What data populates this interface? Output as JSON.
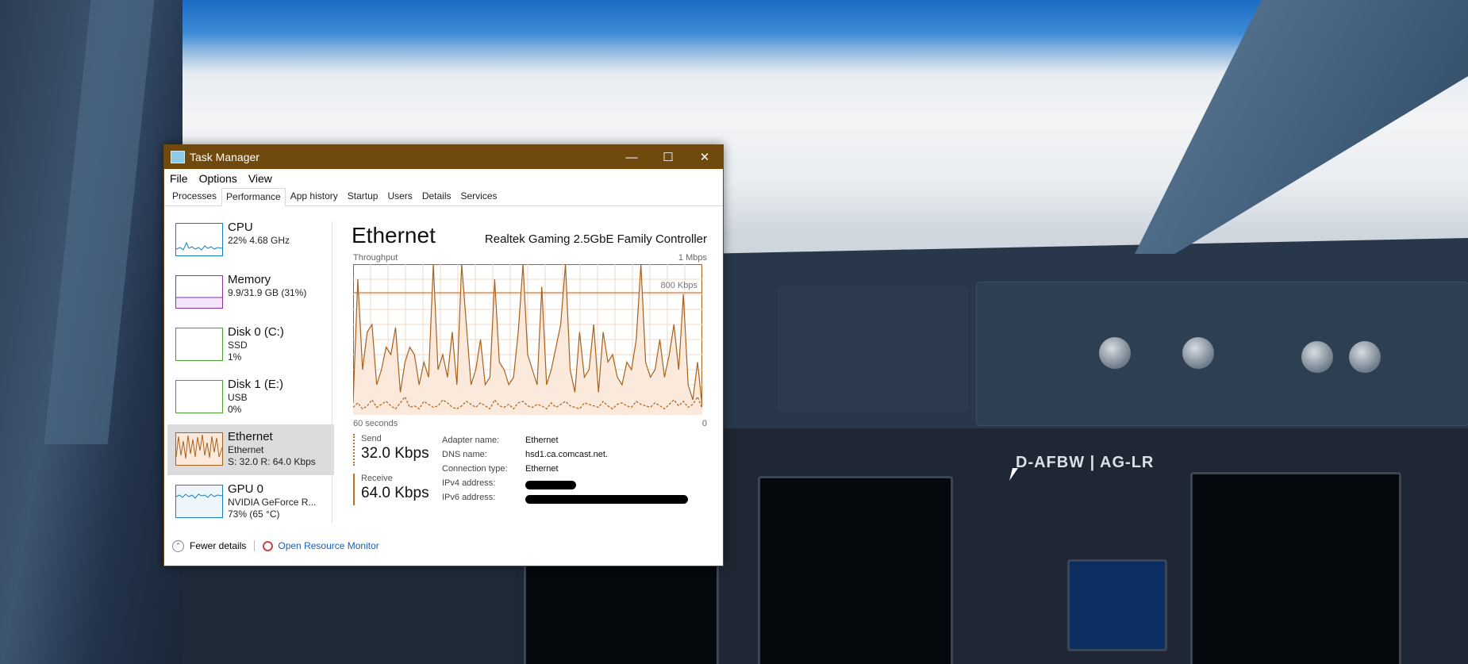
{
  "window": {
    "title": "Task Manager",
    "controls": {
      "minimize": "—",
      "maximize": "☐",
      "close": "✕"
    }
  },
  "menu": [
    "File",
    "Options",
    "View"
  ],
  "tabs": [
    {
      "label": "Processes",
      "active": false
    },
    {
      "label": "Performance",
      "active": true
    },
    {
      "label": "App history",
      "active": false
    },
    {
      "label": "Startup",
      "active": false
    },
    {
      "label": "Users",
      "active": false
    },
    {
      "label": "Details",
      "active": false
    },
    {
      "label": "Services",
      "active": false
    }
  ],
  "sidebar": [
    {
      "title": "CPU",
      "line1": "22% 4.68 GHz",
      "line2": "",
      "color": "#1a7cc4"
    },
    {
      "title": "Memory",
      "line1": "9.9/31.9 GB (31%)",
      "line2": "",
      "color": "#8b2fb0"
    },
    {
      "title": "Disk 0 (C:)",
      "line1": "SSD",
      "line2": "1%",
      "color": "#4aa02c"
    },
    {
      "title": "Disk 1 (E:)",
      "line1": "USB",
      "line2": "0%",
      "color": "#4aa02c"
    },
    {
      "title": "Ethernet",
      "line1": "Ethernet",
      "line2": "S: 32.0 R: 64.0 Kbps",
      "color": "#a8611c"
    },
    {
      "title": "GPU 0",
      "line1": "NVIDIA GeForce R...",
      "line2": "73% (65 °C)",
      "color": "#1a7cc4"
    }
  ],
  "main": {
    "title": "Ethernet",
    "adapter": "Realtek Gaming 2.5GbE Family Controller",
    "throughput_label": "Throughput",
    "max_label": "1 Mbps",
    "ref_label": "800 Kbps",
    "x_left": "60 seconds",
    "x_right": "0",
    "send_label": "Send",
    "send_value": "32.0 Kbps",
    "recv_label": "Receive",
    "recv_value": "64.0 Kbps",
    "props": [
      {
        "key": "Adapter name:",
        "value": "Ethernet"
      },
      {
        "key": "DNS name:",
        "value": "hsd1.ca.comcast.net."
      },
      {
        "key": "Connection type:",
        "value": "Ethernet"
      },
      {
        "key": "IPv4 address:",
        "value": ""
      },
      {
        "key": "IPv6 address:",
        "value": ""
      }
    ]
  },
  "graph_colors": {
    "line": "#a8611c",
    "grid": "#f0d9c4",
    "fill": "#fbe9dc"
  },
  "receive_series": [
    0.08,
    0.9,
    0.3,
    0.55,
    0.6,
    0.2,
    0.3,
    0.45,
    0.4,
    0.58,
    0.15,
    0.35,
    0.45,
    0.4,
    0.2,
    0.35,
    0.25,
    1,
    0.3,
    0.4,
    0.25,
    0.55,
    0.2,
    1,
    0.6,
    0.2,
    0.3,
    0.5,
    0.2,
    0.25,
    0.9,
    0.35,
    0.3,
    0.2,
    0.25,
    0.55,
    1,
    0.4,
    0.3,
    0.2,
    0.85,
    0.2,
    0.3,
    0.45,
    0.6,
    1,
    0.3,
    0.15,
    0.55,
    0.25,
    0.3,
    0.6,
    0.15,
    0.55,
    0.35,
    0.4,
    0.25,
    0.2,
    0.35,
    0.3,
    0.5,
    1,
    0.35,
    0.25,
    0.3,
    0.5,
    0.25,
    0.4,
    0.6,
    0.3,
    0.8,
    0.2,
    0.1,
    0.35,
    0.05
  ],
  "send_series": [
    0.05,
    0.08,
    0.04,
    0.06,
    0.1,
    0.05,
    0.07,
    0.09,
    0.06,
    0.04,
    0.08,
    0.12,
    0.05,
    0.06,
    0.04,
    0.09,
    0.07,
    0.05,
    0.06,
    0.1,
    0.08,
    0.05,
    0.04,
    0.06,
    0.09,
    0.07,
    0.05,
    0.08,
    0.06,
    0.04,
    0.1,
    0.06,
    0.05,
    0.07,
    0.04,
    0.08,
    0.09,
    0.06,
    0.05,
    0.07,
    0.06,
    0.04,
    0.08,
    0.05,
    0.07,
    0.09,
    0.06,
    0.05,
    0.04,
    0.08,
    0.07,
    0.06,
    0.05,
    0.09,
    0.06,
    0.04,
    0.07,
    0.08,
    0.06,
    0.05,
    0.09,
    0.07,
    0.06,
    0.05,
    0.08,
    0.06,
    0.04,
    0.07,
    0.1,
    0.06,
    0.09,
    0.05,
    0.07,
    0.12,
    0.04
  ],
  "footer": {
    "fewer": "Fewer details",
    "resmon": "Open Resource Monitor"
  },
  "background": {
    "registration": "D-AFBW | AG-LR"
  }
}
